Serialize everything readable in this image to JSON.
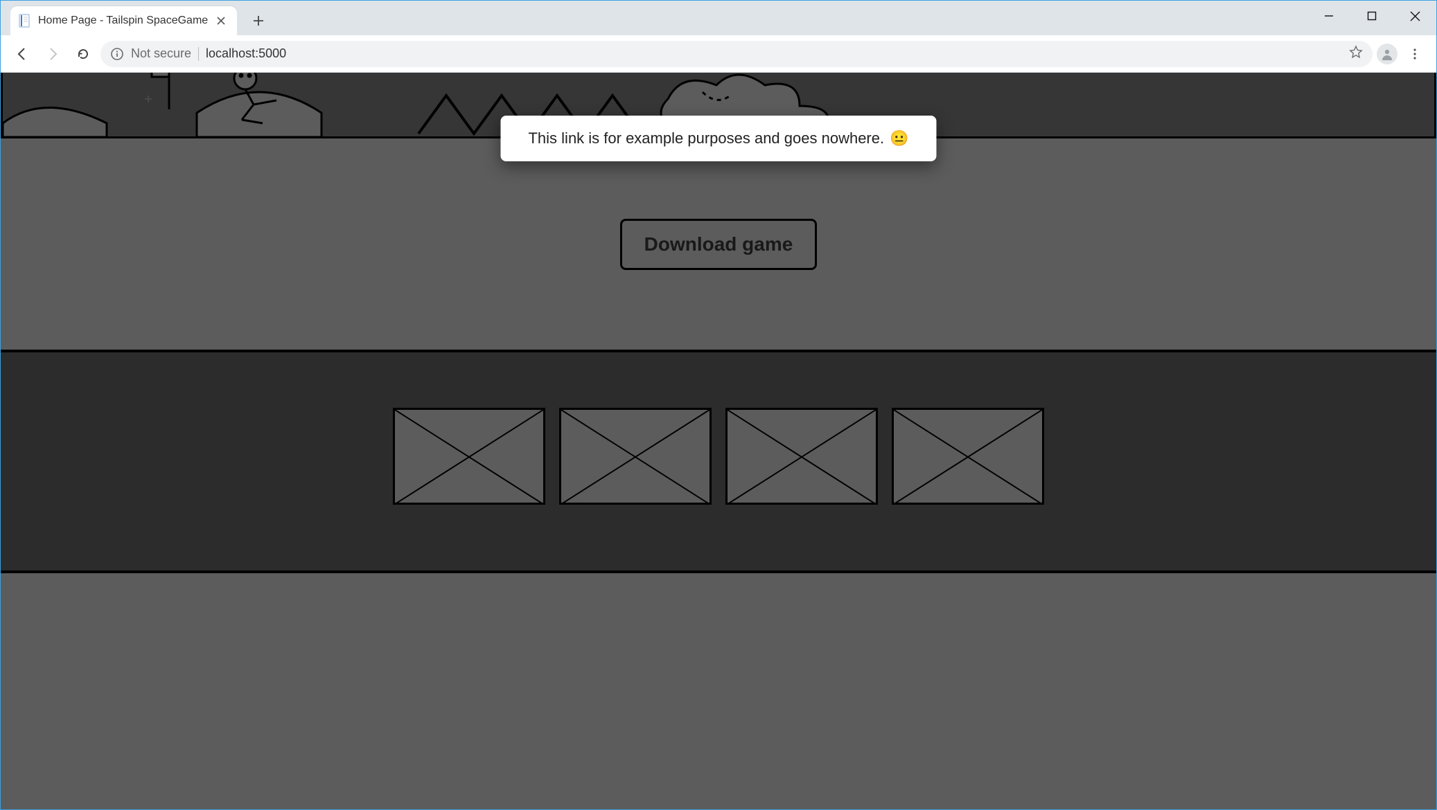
{
  "browser": {
    "tab_title": "Home Page - Tailspin SpaceGame",
    "security_label": "Not secure",
    "url": "localhost:5000"
  },
  "tooltip": {
    "text": "This link is for example purposes and goes nowhere.",
    "emoji": "😐"
  },
  "cta": {
    "download_label": "Download game"
  },
  "gallery": {
    "count": 4
  }
}
